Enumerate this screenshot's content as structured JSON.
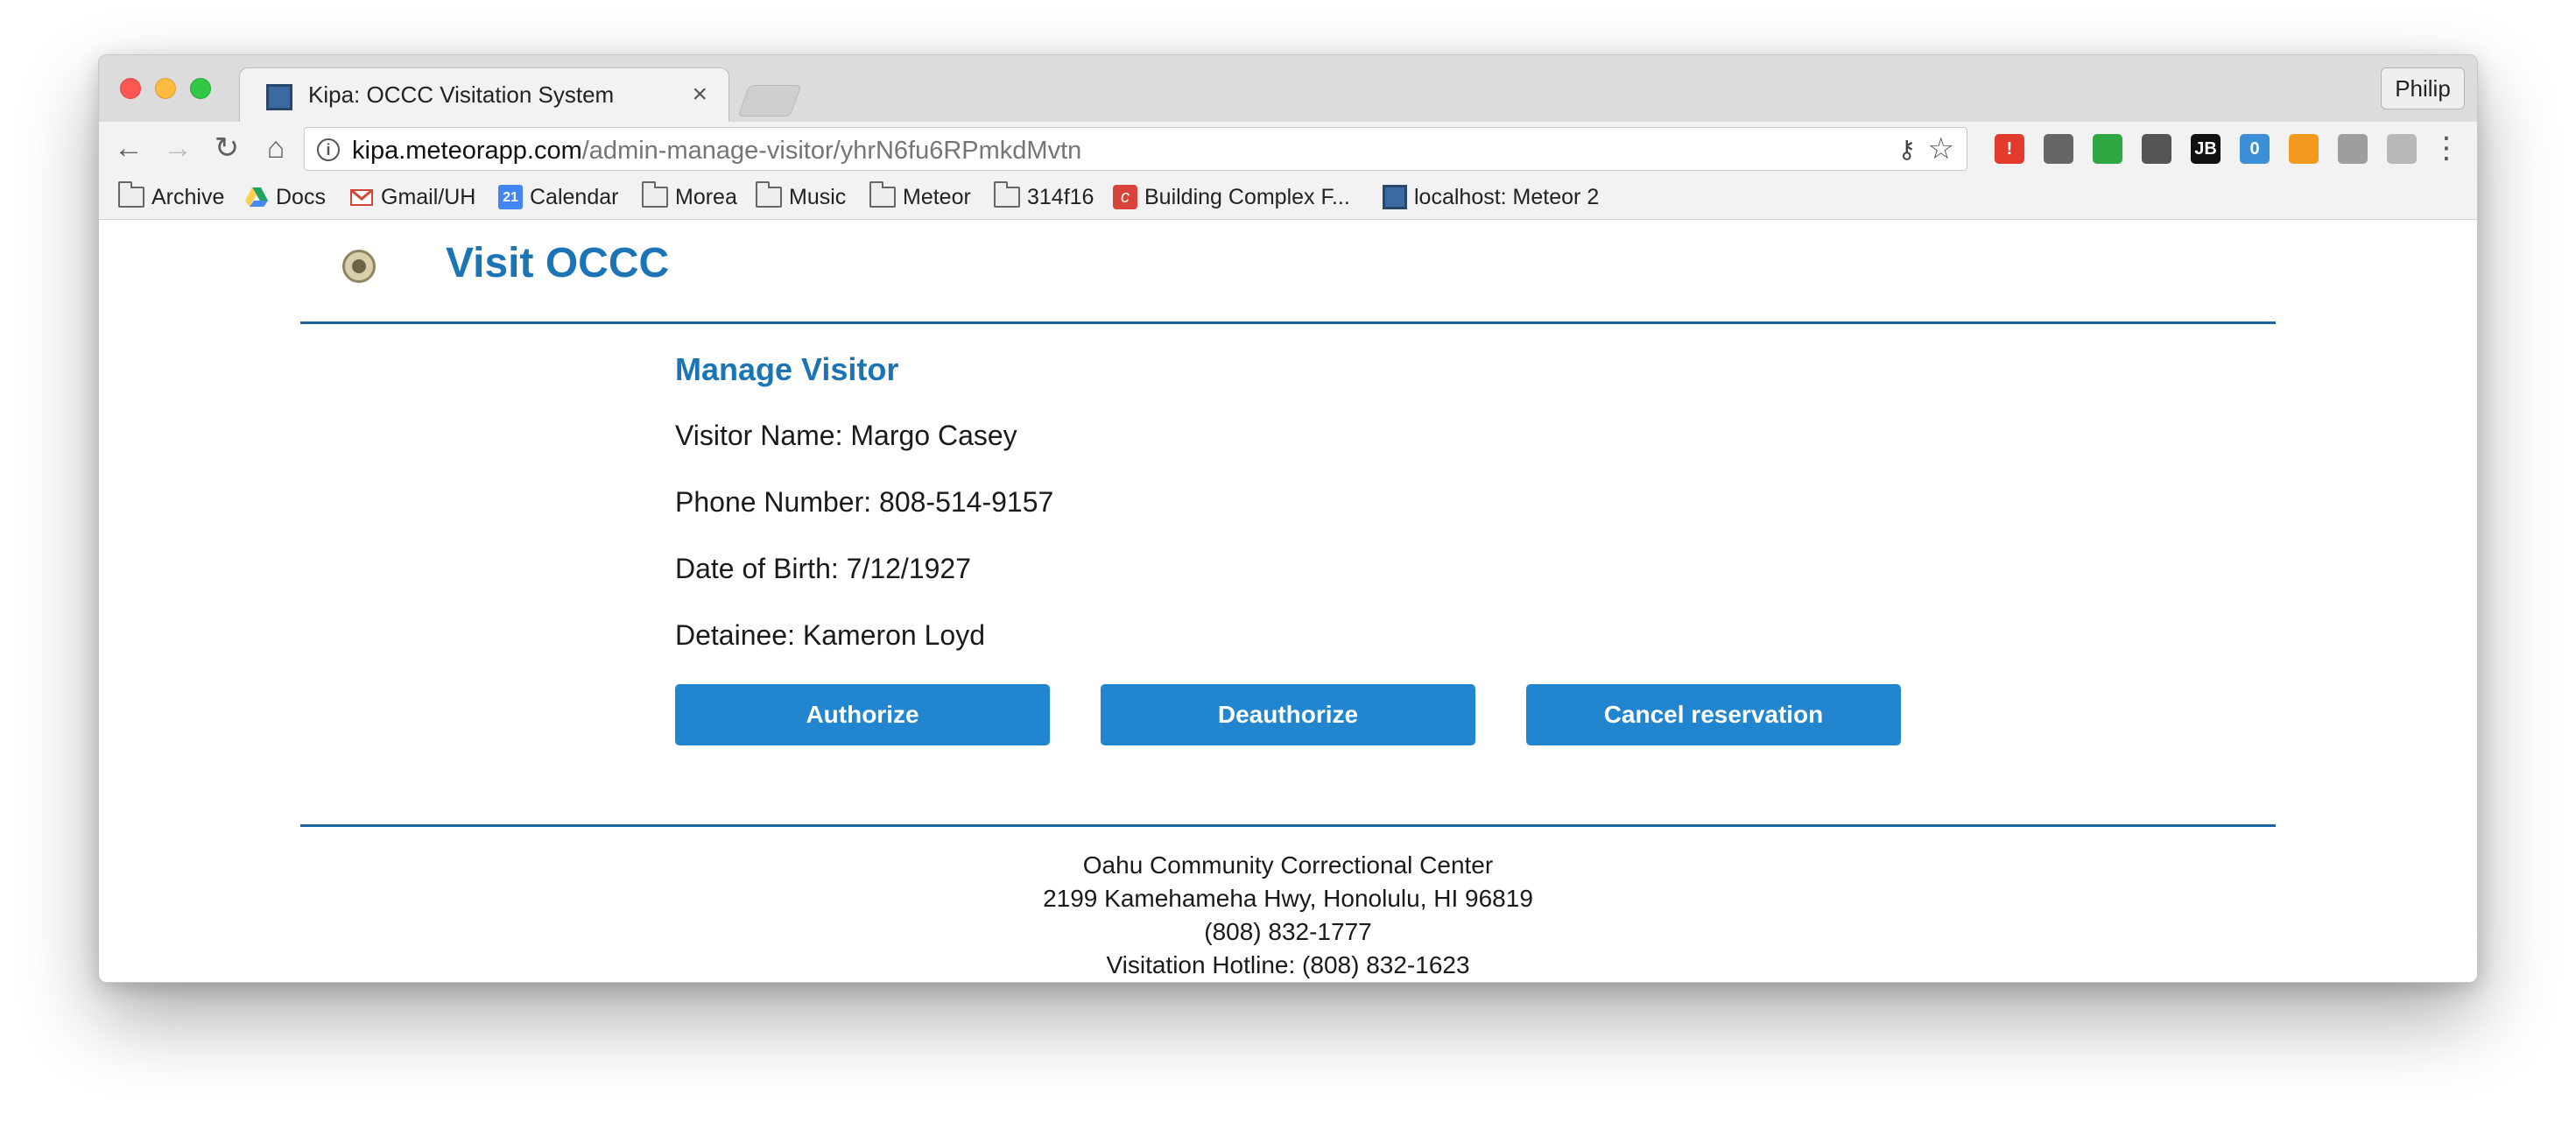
{
  "browser": {
    "tab_title": "Kipa: OCCC Visitation System",
    "tab_close": "×",
    "profile_name": "Philip",
    "url_host": "kipa.meteorapp.com",
    "url_path": "/admin-manage-visitor/yhrN6fu6RPmkdMvtn",
    "nav": {
      "back": "←",
      "forward": "→",
      "reload": "↻",
      "home": "⌂"
    },
    "icons": {
      "info": "i",
      "key": "⚷",
      "star": "☆",
      "menu": "⋮"
    },
    "extensions": [
      {
        "icon": "alert-extension-icon",
        "badge": "!",
        "color": "#e23b2e"
      },
      {
        "icon": "sync-extension-icon",
        "badge": "",
        "color": "#666666"
      },
      {
        "icon": "chat-extension-icon",
        "badge": "",
        "color": "#2fa844"
      },
      {
        "icon": "info-extension-icon",
        "badge": "",
        "color": "#555555"
      },
      {
        "icon": "jb-extension-icon",
        "badge": "JB",
        "color": "#111111"
      },
      {
        "icon": "lock-extension-icon",
        "badge": "0",
        "color": "#3a8fd6"
      },
      {
        "icon": "chart-extension-icon",
        "badge": "",
        "color": "#f29a1f"
      },
      {
        "icon": "gear-extension-icon",
        "badge": "",
        "color": "#9e9e9e"
      },
      {
        "icon": "drive-extension-icon",
        "badge": "",
        "color": "#b8b8b8"
      }
    ],
    "bookmarks": [
      {
        "label": "Archive",
        "icon": "folder-icon"
      },
      {
        "label": "Docs",
        "icon": "google-drive-icon"
      },
      {
        "label": "Gmail/UH",
        "icon": "gmail-icon"
      },
      {
        "label": "Calendar",
        "icon": "calendar-icon",
        "badge": "21"
      },
      {
        "label": "Morea",
        "icon": "folder-icon"
      },
      {
        "label": "Music",
        "icon": "folder-icon"
      },
      {
        "label": "Meteor",
        "icon": "folder-icon"
      },
      {
        "label": "314f16",
        "icon": "folder-icon"
      },
      {
        "label": "Building Complex F...",
        "icon": "building-complex-icon"
      },
      {
        "label": "localhost: Meteor 2",
        "icon": "meteor-site-icon"
      }
    ]
  },
  "page": {
    "site_title": "Visit OCCC",
    "heading": "Manage Visitor",
    "fields": {
      "visitor_name": "Visitor Name: Margo Casey",
      "phone": "Phone Number: 808-514-9157",
      "dob": "Date of Birth: 7/12/1927",
      "detainee": "Detainee: Kameron Loyd"
    },
    "buttons": {
      "authorize": "Authorize",
      "deauthorize": "Deauthorize",
      "cancel": "Cancel reservation"
    },
    "footer": {
      "line1": "Oahu Community Correctional Center",
      "line2": "2199 Kamehameha Hwy, Honolulu, HI 96819",
      "line3": "(808) 832-1777",
      "line4": "Visitation Hotline: (808) 832-1623"
    },
    "colors": {
      "brand_blue": "#1b74b6",
      "button_blue": "#2185d0",
      "rule_blue": "#1c63a2"
    }
  }
}
